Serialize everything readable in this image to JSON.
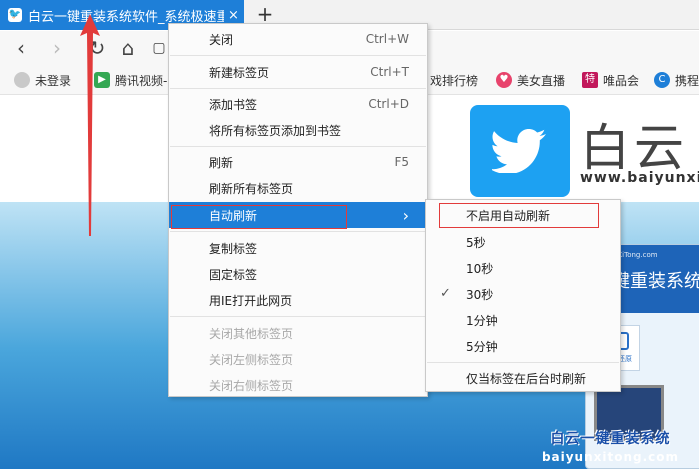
{
  "tab": {
    "favicon": "bird-icon",
    "title": "白云一键重装系统软件_系统极速重装",
    "close_label": "×",
    "new_tab_label": "+"
  },
  "nav": {
    "back": "‹",
    "forward": "›",
    "reload": "↻",
    "home": "⌂"
  },
  "bookmarks": [
    {
      "label": "未登录",
      "icon": "user-icon",
      "color": "#c9c9c9"
    },
    {
      "label": "腾讯视频-",
      "icon": "play-icon",
      "color": "#34a853"
    },
    {
      "label": "戏排行榜",
      "icon": "game-icon",
      "color": "#f7f7f7"
    },
    {
      "label": "美女直播",
      "icon": "heart-icon",
      "color": "#e8436c"
    },
    {
      "label": "唯品会",
      "icon": "vip-icon",
      "color": "#c2185b"
    },
    {
      "label": "携程",
      "icon": "ctrip-icon",
      "color": "#1e7fd8"
    }
  ],
  "page": {
    "brand_text": "白云",
    "brand_url": "www.baiyunxi",
    "box_small": "BaiYunXiTong.com",
    "box_big": "一键重装系统",
    "tile_label": "备份还原",
    "watermark_title": "白云一键重装系统",
    "watermark_url": "baiyunxitong.com"
  },
  "context_menu": {
    "items": [
      {
        "label": "关闭",
        "shortcut": "Ctrl+W"
      },
      {
        "label": "新建标签页",
        "shortcut": "Ctrl+T"
      },
      {
        "label": "添加书签",
        "shortcut": "Ctrl+D"
      },
      {
        "label": "将所有标签页添加到书签",
        "shortcut": ""
      },
      {
        "label": "刷新",
        "shortcut": "F5"
      },
      {
        "label": "刷新所有标签页",
        "shortcut": ""
      },
      {
        "label": "自动刷新",
        "shortcut": "›"
      },
      {
        "label": "复制标签",
        "shortcut": ""
      },
      {
        "label": "固定标签",
        "shortcut": ""
      },
      {
        "label": "用IE打开此网页",
        "shortcut": ""
      },
      {
        "label": "关闭其他标签页",
        "shortcut": ""
      },
      {
        "label": "关闭左侧标签页",
        "shortcut": ""
      },
      {
        "label": "关闭右侧标签页",
        "shortcut": ""
      }
    ]
  },
  "auto_refresh_submenu": {
    "check_mark": "✓",
    "items": [
      {
        "label": "不启用自动刷新"
      },
      {
        "label": "5秒"
      },
      {
        "label": "10秒"
      },
      {
        "label": "30秒",
        "checked": true
      },
      {
        "label": "1分钟"
      },
      {
        "label": "5分钟"
      },
      {
        "label": "仅当标签在后台时刷新"
      }
    ]
  },
  "colors": {
    "accent": "#1e7fd8",
    "annotation": "#e23b3b"
  }
}
